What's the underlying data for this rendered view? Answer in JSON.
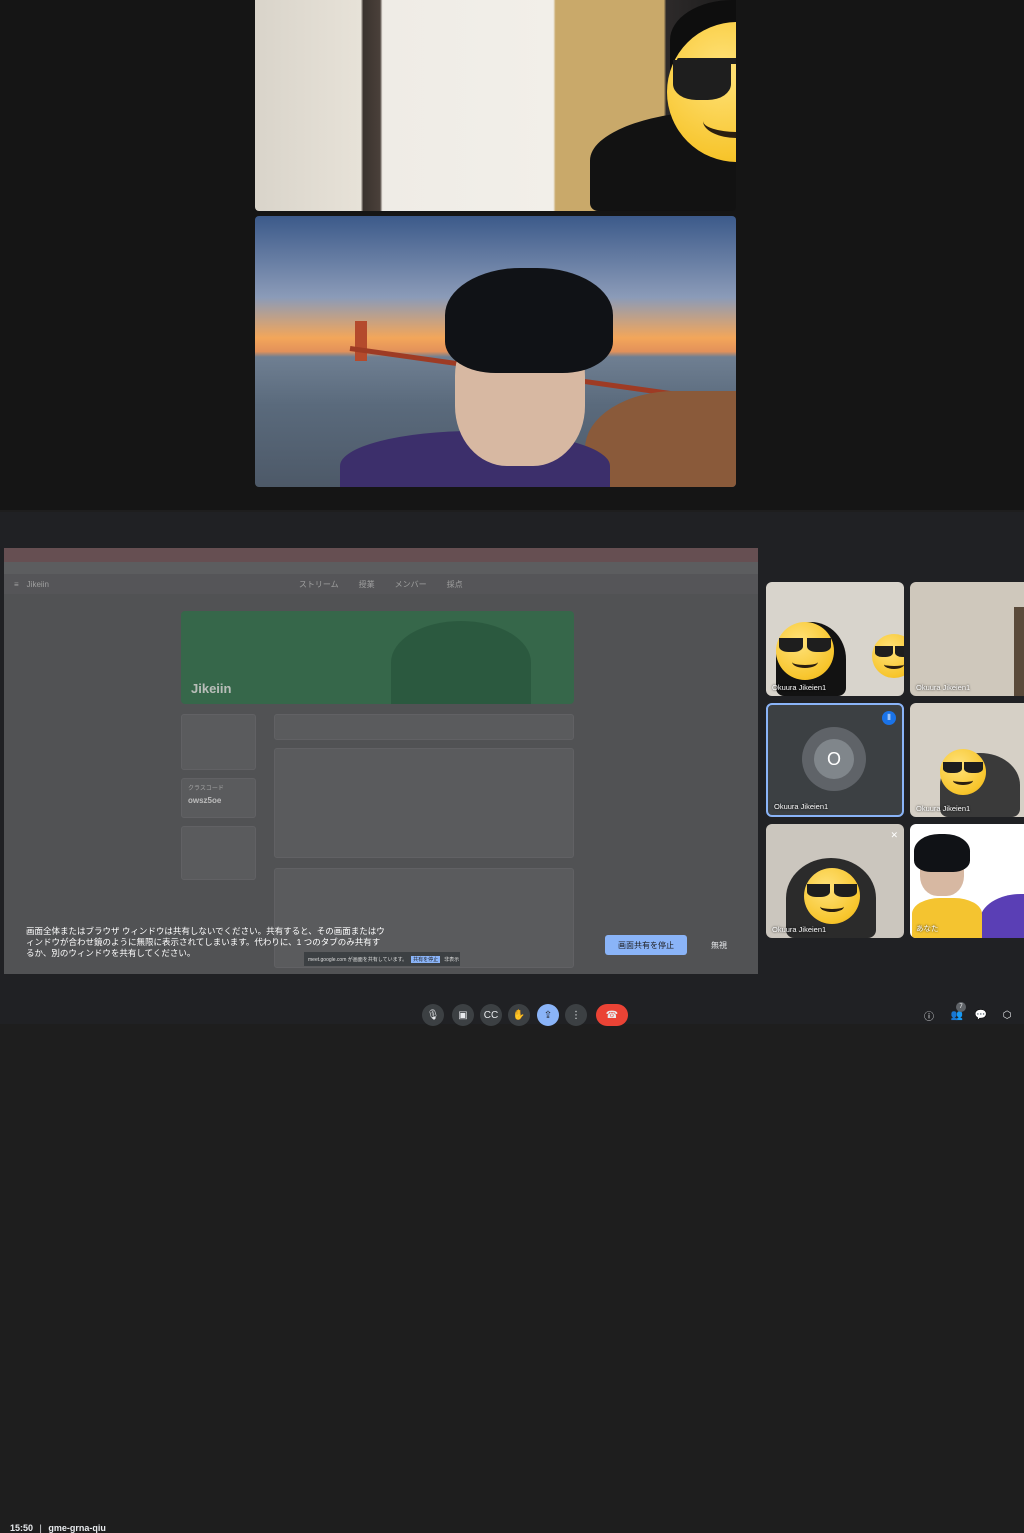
{
  "shared_screen": {
    "class_title": "Jikeiin",
    "banner_title": "Jikeiin",
    "nav_tabs": [
      "ストリーム",
      "授業",
      "メンバー",
      "採点"
    ],
    "class_code_label": "クラスコード",
    "class_code": "owsz5oe",
    "notice": "画面全体またはブラウザ ウィンドウは共有しないでください。共有すると、その画面またはウィンドウが合わせ鏡のように無限に表示されてしまいます。代わりに、1 つのタブのみ共有するか、別のウィンドウを共有してください。",
    "stop_share_label": "画面共有を停止",
    "ignore_label": "無視",
    "sharing_bar_text": "meet.google.com が画面を共有しています。",
    "sharing_bar_stop": "共有を停止",
    "sharing_bar_hide": "非表示"
  },
  "participants": [
    {
      "name": "Okuura Jikeien1"
    },
    {
      "name": "Okuura Jikeien1"
    },
    {
      "name": "Okuura Jikeien1",
      "avatar_initial": "O"
    },
    {
      "name": "Okuura Jikeien1"
    },
    {
      "name": "Okuura Jikeien1"
    },
    {
      "name": "あなた"
    }
  ],
  "footer": {
    "time": "15:50",
    "separator": "|",
    "meeting_code": "gme-grna-qiu",
    "people_count": "7"
  },
  "colors": {
    "stop_share_bg": "#8ab4f8",
    "end_call_bg": "#ea4335",
    "active_tile_border": "#8ab4f8"
  }
}
